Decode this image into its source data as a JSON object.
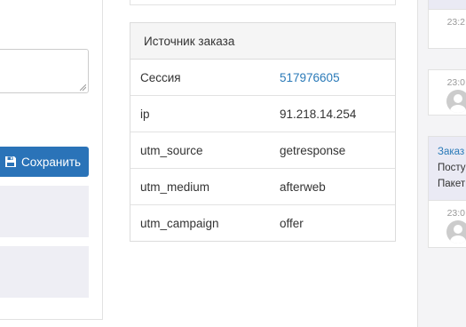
{
  "left": {
    "save_label": "Сохранить"
  },
  "source": {
    "title": "Источник заказа",
    "rows": [
      {
        "key": "Сессия",
        "value": "517976605"
      },
      {
        "key": "ip",
        "value": "91.218.14.254"
      },
      {
        "key": "utm_source",
        "value": "getresponse"
      },
      {
        "key": "utm_medium",
        "value": "afterweb"
      },
      {
        "key": "utm_campaign",
        "value": "offer"
      }
    ]
  },
  "feed": {
    "items": [
      {
        "time": "23:2"
      },
      {
        "time": "23:0"
      },
      {
        "title": "Заказ",
        "line1": "Посту",
        "line2": "Пакет",
        "time": "23:0"
      }
    ]
  },
  "colors": {
    "primary": "#2a73b8",
    "link": "#2a7ab8"
  }
}
